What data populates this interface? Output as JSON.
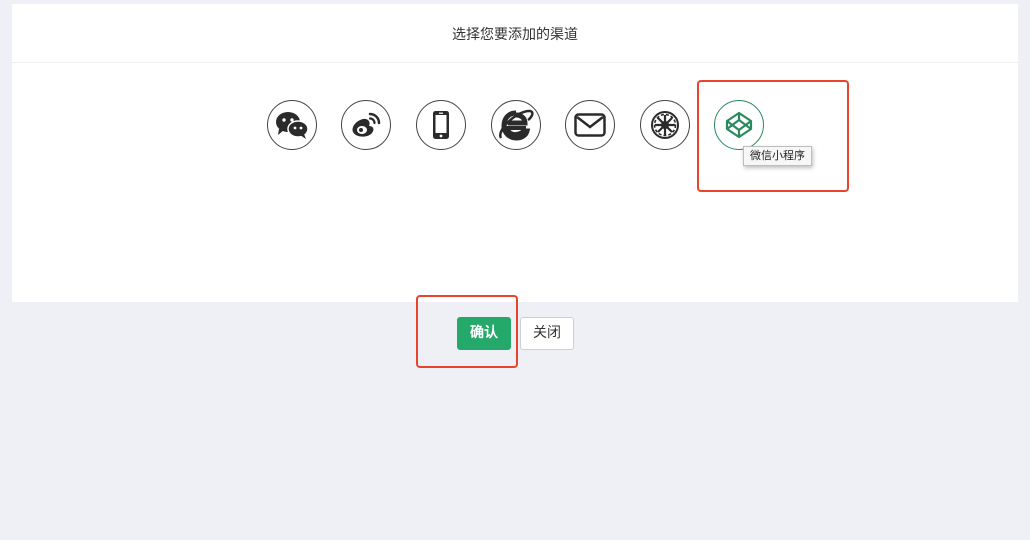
{
  "dialog": {
    "title": "选择您要添加的渠道"
  },
  "channels": [
    {
      "icon": "wechat-icon"
    },
    {
      "icon": "weibo-icon"
    },
    {
      "icon": "mobile-icon"
    },
    {
      "icon": "ie-browser-icon"
    },
    {
      "icon": "email-icon"
    },
    {
      "icon": "empire-icon"
    },
    {
      "icon": "codepen-icon",
      "selected": true
    }
  ],
  "tooltip": {
    "text": "微信小程序"
  },
  "buttons": {
    "confirm_label": "确认",
    "close_label": "关闭"
  },
  "colors": {
    "accent": "#24a96b",
    "highlight": "#e8452c",
    "background": "#eff0f5"
  }
}
